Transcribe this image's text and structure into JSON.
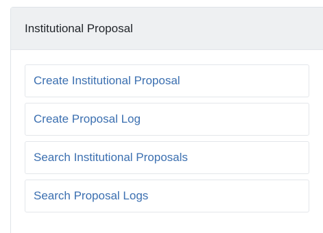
{
  "panel": {
    "title": "Institutional Proposal",
    "links": [
      {
        "label": "Create Institutional Proposal"
      },
      {
        "label": "Create Proposal Log"
      },
      {
        "label": "Search Institutional Proposals"
      },
      {
        "label": "Search Proposal Logs"
      }
    ]
  },
  "colors": {
    "link": "#3b6fb0",
    "header_bg": "#eef0f2",
    "title_text": "#1f2328",
    "border": "#e3e6ea"
  }
}
